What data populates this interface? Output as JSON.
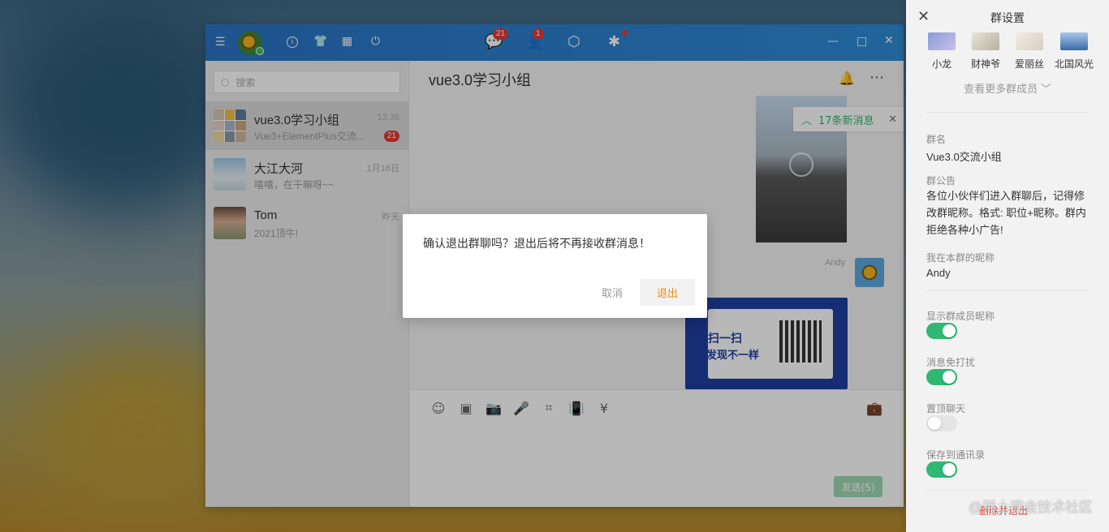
{
  "titlebar": {
    "badges": {
      "messages": "21",
      "contacts": "1"
    }
  },
  "sidebar": {
    "search_placeholder": "搜索",
    "chats": [
      {
        "name": "vue3.0学习小组",
        "time": "13:38",
        "preview": "Vue3+ElementPlus交流...",
        "unread": "21"
      },
      {
        "name": "大江大河",
        "time": "1月16日",
        "preview": "嘻嘻，在干嘛呀~~"
      },
      {
        "name": "Tom",
        "time": "昨天",
        "preview": "2021顶牛!"
      }
    ]
  },
  "main": {
    "title": "vue3.0学习小组",
    "new_messages": "17条新消息",
    "sender": "Andy",
    "poster": {
      "line1": "扫一扫",
      "line2": "发现不一样"
    },
    "send_label": "发送(S)"
  },
  "dialog": {
    "message": "确认退出群聊吗？退出后将不再接收群消息！",
    "cancel_label": "取消",
    "exit_label": "退出"
  },
  "panel": {
    "title": "群设置",
    "members": [
      "小龙",
      "财神爷",
      "爱丽丝",
      "北国风光"
    ],
    "more_members": "查看更多群成员",
    "group_name_label": "群名",
    "group_name": "Vue3.0交流小组",
    "notice_label": "群公告",
    "notice": "各位小伙伴们进入群聊后，记得修改群昵称。格式: 职位+昵称。群内拒绝各种小广告!",
    "nickname_label": "我在本群的昵称",
    "nickname": "Andy",
    "settings": [
      {
        "label": "显示群成员昵称",
        "on": true
      },
      {
        "label": "消息免打扰",
        "on": true
      },
      {
        "label": "置顶聊天",
        "on": false
      },
      {
        "label": "保存到通讯录",
        "on": true
      }
    ],
    "exit_link": "删除并退出"
  },
  "watermark": "@稀土掘金技术社区",
  "colors": {
    "accent": "#2b74c4",
    "toggle_on": "#2eb872",
    "exit": "#f08a1c"
  }
}
